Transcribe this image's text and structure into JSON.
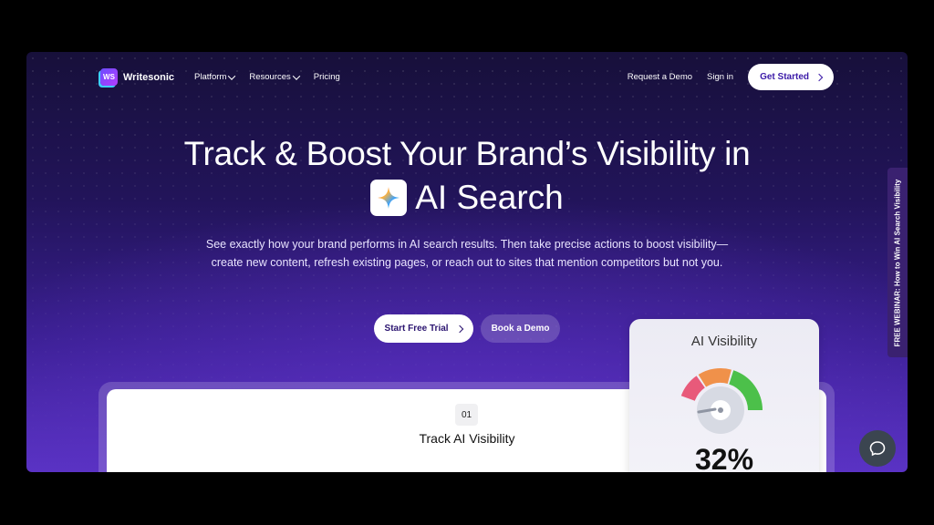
{
  "nav": {
    "logo_mark": "WS",
    "logo_text": "Writesonic",
    "links": [
      {
        "label": "Platform"
      },
      {
        "label": "Resources"
      },
      {
        "label": "Pricing"
      }
    ],
    "request_demo": "Request a Demo",
    "sign_in": "Sign in",
    "get_started": "Get Started"
  },
  "hero": {
    "headline_line1": "Track & Boost Your Brand’s Visibility in",
    "headline_line2": "AI Search",
    "subtext": "See exactly how your brand performs in AI search results. Then take precise actions to boost visibility—create new content, refresh existing pages, or reach out to sites that mention competitors but not you.",
    "primary_button": "Start Free Trial",
    "secondary_button": "Book a Demo"
  },
  "step": {
    "number": "01",
    "title": "Track AI Visibility"
  },
  "visibility_card": {
    "title": "AI Visibility",
    "value": "32%",
    "percent": 32,
    "segment_colors": [
      "#e85a7a",
      "#f0914a",
      "#4cc04a"
    ]
  },
  "side_tab": {
    "label": "FREE WEBINAR: How to Win AI Search Visibility"
  },
  "colors": {
    "bg_top": "#17103a",
    "bg_bottom": "#5a34c6",
    "accent": "#3b1aa8"
  }
}
